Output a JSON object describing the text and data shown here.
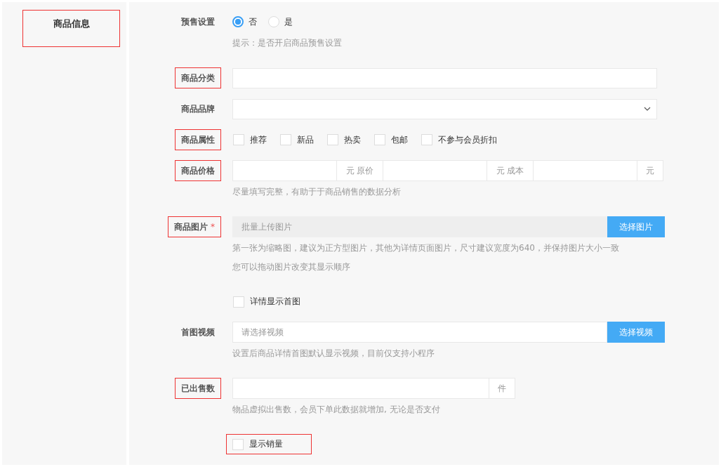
{
  "sidebar": {
    "title": "商品信息",
    "highlighted": true
  },
  "form": [
    {
      "kind": "radio",
      "label": "预售设置",
      "highlighted": false,
      "options": [
        {
          "label": "否",
          "selected": true
        },
        {
          "label": "是",
          "selected": false
        }
      ],
      "hints": [
        "提示：是否开启商品预售设置"
      ]
    },
    {
      "kind": "text",
      "label": "商品分类",
      "highlighted": true
    },
    {
      "kind": "select",
      "label": "商品品牌",
      "highlighted": false
    },
    {
      "kind": "checkboxes",
      "label": "商品属性",
      "highlighted": true,
      "options": [
        {
          "label": "推荐",
          "checked": false
        },
        {
          "label": "新品",
          "checked": false
        },
        {
          "label": "热卖",
          "checked": false
        },
        {
          "label": "包邮",
          "checked": false
        },
        {
          "label": "不参与会员折扣",
          "checked": false
        }
      ]
    },
    {
      "kind": "price",
      "label": "商品价格",
      "highlighted": true,
      "units": [
        "元 原价",
        "元 成本",
        "元"
      ],
      "hints": [
        "尽量填写完整，有助于于商品销售的数据分析"
      ]
    },
    {
      "kind": "upload",
      "label": "商品图片",
      "required_mark": "*",
      "highlighted": true,
      "readonly": true,
      "placeholder": "批量上传图片",
      "button": "选择图片",
      "hints": [
        "第一张为缩略图，建议为正方型图片，其他为详情页面图片，尺寸建议宽度为640，并保持图片大小一致",
        "您可以拖动图片改变其显示顺序"
      ]
    },
    {
      "kind": "checkbox",
      "text": "详情显示首图",
      "checked": false,
      "highlighted": false
    },
    {
      "kind": "upload",
      "label": "首图视频",
      "highlighted": false,
      "readonly": false,
      "placeholder": "请选择视频",
      "button": "选择视频",
      "hints": [
        "设置后商品详情首图默认显示视频，目前仅支持小程序"
      ]
    },
    {
      "kind": "unit",
      "label": "已出售数",
      "highlighted": true,
      "unit": "件",
      "hints": [
        "物品虚拟出售数，会员下单此数据就增加, 无论是否支付"
      ]
    },
    {
      "kind": "checkbox",
      "text": "显示销量",
      "checked": false,
      "highlighted": true
    }
  ]
}
